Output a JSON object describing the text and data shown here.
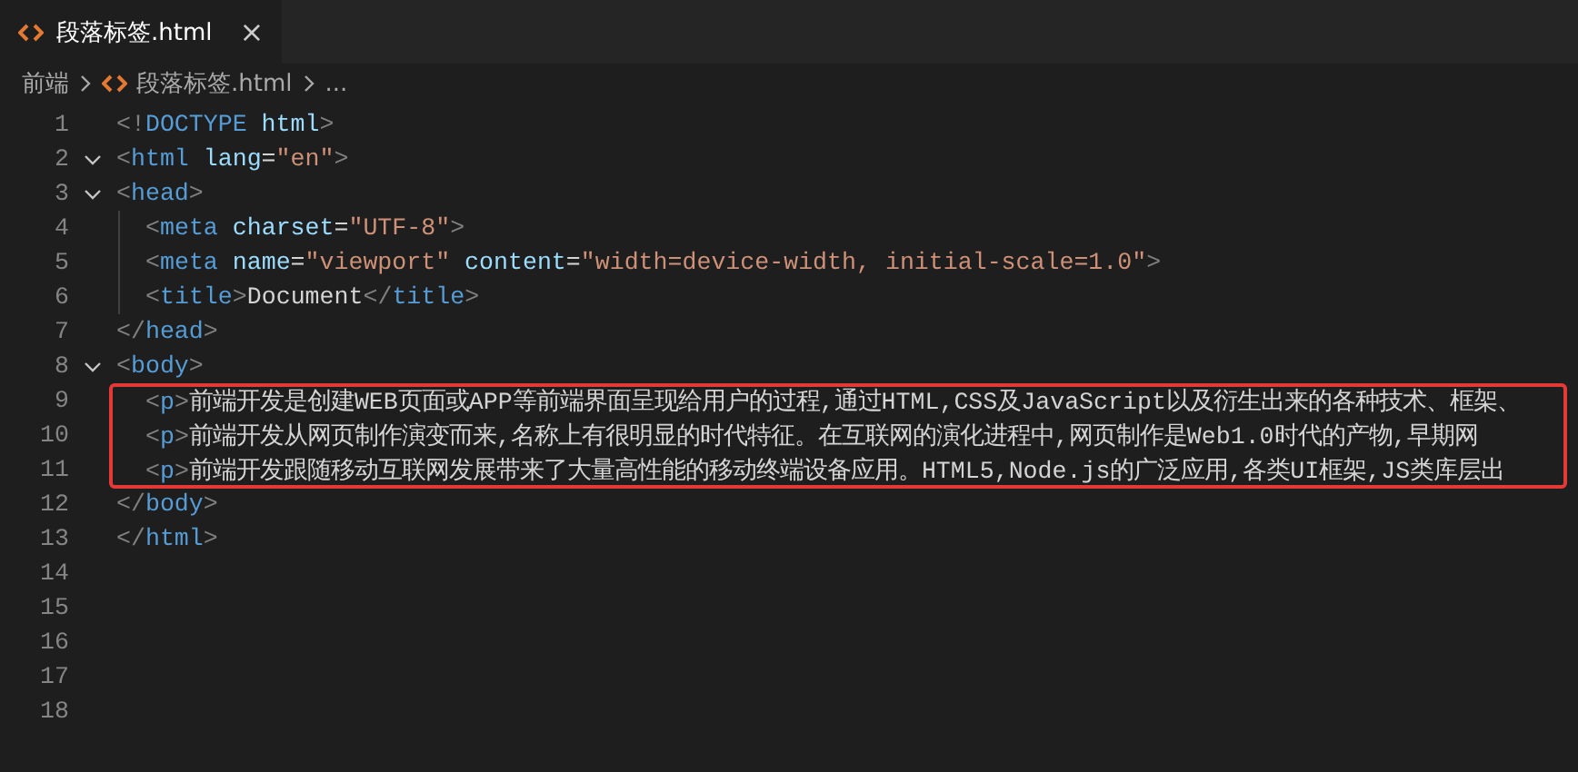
{
  "tabs": [
    {
      "label": "段落标签.html",
      "selected": true,
      "close": "×"
    }
  ],
  "breadcrumb": [
    {
      "label": "前端",
      "kind": "folder"
    },
    {
      "label": "段落标签.html",
      "kind": "file"
    },
    {
      "label": "...",
      "kind": "more"
    }
  ],
  "lines": [
    {
      "number": "1",
      "words": [
        [
          {
            "kind": "punct",
            "text": "<!"
          },
          {
            "kind": "tag",
            "text": "DOCTYPE"
          }
        ],
        [
          {
            "kind": "attr",
            "text": "html"
          },
          {
            "kind": "punct",
            "text": ">"
          }
        ]
      ]
    },
    {
      "number": "2",
      "expanded": true,
      "words": [
        [
          {
            "kind": "punct",
            "text": "<"
          },
          {
            "kind": "tag",
            "text": "html"
          }
        ],
        [
          {
            "kind": "attr",
            "text": "lang"
          },
          {
            "kind": "eq",
            "text": "="
          },
          {
            "kind": "string",
            "text": "\"en\""
          },
          {
            "kind": "punct",
            "text": ">"
          }
        ]
      ]
    },
    {
      "number": "3",
      "expanded": true,
      "words": [
        [
          {
            "kind": "punct",
            "text": "<"
          },
          {
            "kind": "tag",
            "text": "head"
          },
          {
            "kind": "punct",
            "text": ">"
          }
        ]
      ],
      "children": [
        {
          "number": "4",
          "words": [
            [
              {
                "kind": "punct",
                "text": "<"
              },
              {
                "kind": "tag",
                "text": "meta"
              }
            ],
            [
              {
                "kind": "attr",
                "text": "charset"
              },
              {
                "kind": "eq",
                "text": "="
              },
              {
                "kind": "string",
                "text": "\"UTF-8\""
              },
              {
                "kind": "punct",
                "text": ">"
              }
            ]
          ]
        },
        {
          "number": "5",
          "words": [
            [
              {
                "kind": "punct",
                "text": "<"
              },
              {
                "kind": "tag",
                "text": "meta"
              }
            ],
            [
              {
                "kind": "attr",
                "text": "name"
              },
              {
                "kind": "eq",
                "text": "="
              },
              {
                "kind": "string",
                "text": "\"viewport\""
              }
            ],
            [
              {
                "kind": "attr",
                "text": "content"
              },
              {
                "kind": "eq",
                "text": "="
              },
              {
                "kind": "string",
                "text": "\"width=device-width, initial-scale=1.0\""
              },
              {
                "kind": "punct",
                "text": ">"
              }
            ]
          ]
        },
        {
          "number": "6",
          "words": [
            [
              {
                "kind": "punct",
                "text": "<"
              },
              {
                "kind": "tag",
                "text": "title"
              },
              {
                "kind": "punct",
                "text": ">"
              },
              {
                "kind": "text",
                "text": "Document"
              },
              {
                "kind": "punct",
                "text": "</"
              },
              {
                "kind": "tag",
                "text": "title"
              },
              {
                "kind": "punct",
                "text": ">"
              }
            ]
          ]
        }
      ]
    },
    {
      "number": "7",
      "words": [
        [
          {
            "kind": "punct",
            "text": "</"
          },
          {
            "kind": "tag",
            "text": "head"
          },
          {
            "kind": "punct",
            "text": ">"
          }
        ]
      ]
    },
    {
      "number": "8",
      "expanded": true,
      "boxed": true,
      "words": [
        [
          {
            "kind": "punct",
            "text": "<"
          },
          {
            "kind": "tag",
            "text": "body"
          },
          {
            "kind": "punct",
            "text": ">"
          }
        ]
      ],
      "children": [
        {
          "number": "9",
          "words": [
            [
              {
                "kind": "punct",
                "text": "<"
              },
              {
                "kind": "tag",
                "text": "p"
              },
              {
                "kind": "punct",
                "text": ">"
              },
              {
                "kind": "text",
                "text": "前端开发是创建WEB页面或APP等前端界面呈现给用户的过程,通过HTML,CSS及JavaScript以及衍生出来的各种技术、框架、"
              }
            ]
          ]
        },
        {
          "number": "10",
          "words": [
            [
              {
                "kind": "punct",
                "text": "<"
              },
              {
                "kind": "tag",
                "text": "p"
              },
              {
                "kind": "punct",
                "text": ">"
              },
              {
                "kind": "text",
                "text": "前端开发从网页制作演变而来,名称上有很明显的时代特征。在互联网的演化进程中,网页制作是Web1.0时代的产物,早期网"
              }
            ]
          ]
        },
        {
          "number": "11",
          "words": [
            [
              {
                "kind": "punct",
                "text": "<"
              },
              {
                "kind": "tag",
                "text": "p"
              },
              {
                "kind": "punct",
                "text": ">"
              },
              {
                "kind": "text",
                "text": "前端开发跟随移动互联网发展带来了大量高性能的移动终端设备应用。HTML5,Node.js的广泛应用,各类UI框架,JS类库层出"
              }
            ]
          ]
        }
      ]
    },
    {
      "number": "12",
      "words": [
        [
          {
            "kind": "punct",
            "text": "</"
          },
          {
            "kind": "tag",
            "text": "body"
          },
          {
            "kind": "punct",
            "text": ">"
          }
        ]
      ]
    },
    {
      "number": "13",
      "words": [
        [
          {
            "kind": "punct",
            "text": "</"
          },
          {
            "kind": "tag",
            "text": "html"
          },
          {
            "kind": "punct",
            "text": ">"
          }
        ]
      ]
    },
    {
      "number": "14"
    },
    {
      "number": "15"
    },
    {
      "number": "16"
    },
    {
      "number": "17"
    },
    {
      "number": "18"
    }
  ]
}
